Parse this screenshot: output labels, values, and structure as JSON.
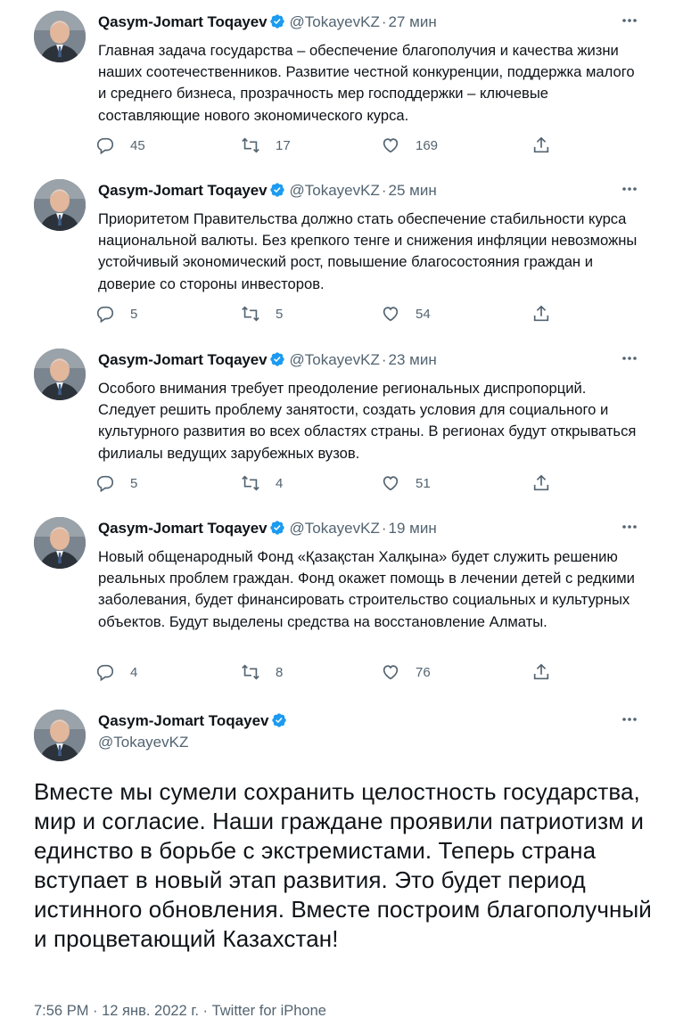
{
  "author": {
    "name": "Qasym-Jomart Toqayev",
    "handle": "@TokayevKZ"
  },
  "colors": {
    "text": "#0f1419",
    "secondary": "#536471",
    "verified": "#1d9bf0"
  },
  "icons": [
    "reply-icon",
    "retweet-icon",
    "like-icon",
    "share-icon",
    "verified-badge-icon",
    "more-icon"
  ],
  "thread": [
    {
      "time": "27 мин",
      "text": "Главная задача государства – обеспечение благополучия и качества жизни наших соотечественников. Развитие честной конкуренции, поддержка малого и среднего бизнеса, прозрачность мер господдержки – ключевые составляющие нового экономического курса.",
      "replies": "45",
      "retweets": "17",
      "likes": "169"
    },
    {
      "time": "25 мин",
      "text": "Приоритетом Правительства должно стать обеспечение стабильности курса национальной валюты. Без крепкого тенге и снижения инфляции невозможны устойчивый экономический рост, повышение благосостояния граждан и доверие со стороны инвесторов.",
      "replies": "5",
      "retweets": "5",
      "likes": "54"
    },
    {
      "time": "23 мин",
      "text": "Особого внимания требует преодоление региональных диспропорций. Следует решить проблему занятости, создать условия для социального и культурного развития во всех областях страны. В регионах будут открываться филиалы ведущих зарубежных вузов.",
      "replies": "5",
      "retweets": "4",
      "likes": "51"
    },
    {
      "time": "19 мин",
      "text": "Новый общенародный Фонд «Қазақстан Халқына» будет служить решению реальных проблем граждан. Фонд окажет помощь в лечении детей с редкими заболевания, будет финансировать строительство социальных и культурных объектов. Будут выделены средства на восстановление Алматы.",
      "replies": "4",
      "retweets": "8",
      "likes": "76"
    }
  ],
  "main_tweet": {
    "text": "Вместе мы сумели сохранить целостность государства, мир и согласие. Наши граждане проявили патриотизм и единство в борьбе с экстремистами. Теперь страна вступает в новый этап развития. Это будет период истинного обновления. Вместе построим благополучный и процветающий Казахстан!",
    "meta": "7:56 PM · 12 янв. 2022 г. · Twitter for iPhone"
  }
}
